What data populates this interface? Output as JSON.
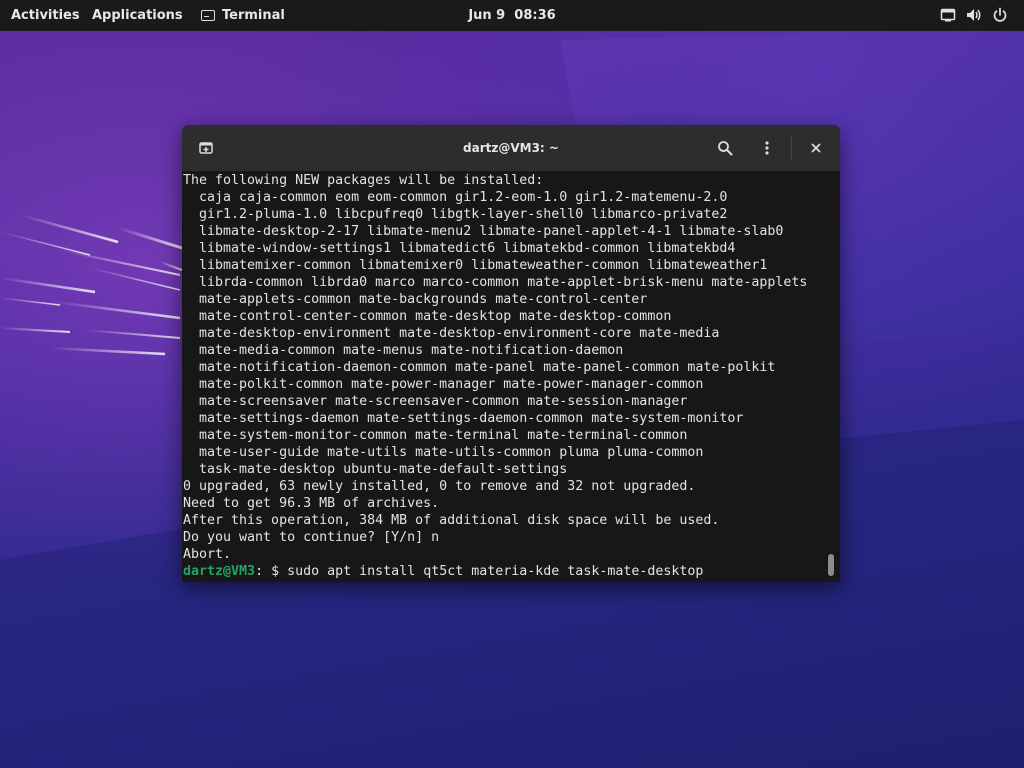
{
  "topbar": {
    "activities_label": "Activities",
    "applications_label": "Applications",
    "app_label": "Terminal",
    "clock": "Jun 9  08:36",
    "tray_icons": [
      "network-icon",
      "volume-icon",
      "power-icon"
    ]
  },
  "terminal": {
    "title": "dartz@VM3: ~",
    "header_icons": [
      "new-tab-icon",
      "search-icon",
      "menu-icon",
      "close-icon"
    ],
    "output_lines": [
      "The following NEW packages will be installed:",
      "  caja caja-common eom eom-common gir1.2-eom-1.0 gir1.2-matemenu-2.0",
      "  gir1.2-pluma-1.0 libcpufreq0 libgtk-layer-shell0 libmarco-private2",
      "  libmate-desktop-2-17 libmate-menu2 libmate-panel-applet-4-1 libmate-slab0",
      "  libmate-window-settings1 libmatedict6 libmatekbd-common libmatekbd4",
      "  libmatemixer-common libmatemixer0 libmateweather-common libmateweather1",
      "  librda-common librda0 marco marco-common mate-applet-brisk-menu mate-applets",
      "  mate-applets-common mate-backgrounds mate-control-center",
      "  mate-control-center-common mate-desktop mate-desktop-common",
      "  mate-desktop-environment mate-desktop-environment-core mate-media",
      "  mate-media-common mate-menus mate-notification-daemon",
      "  mate-notification-daemon-common mate-panel mate-panel-common mate-polkit",
      "  mate-polkit-common mate-power-manager mate-power-manager-common",
      "  mate-screensaver mate-screensaver-common mate-session-manager",
      "  mate-settings-daemon mate-settings-daemon-common mate-system-monitor",
      "  mate-system-monitor-common mate-terminal mate-terminal-common",
      "  mate-user-guide mate-utils mate-utils-common pluma pluma-common",
      "  task-mate-desktop ubuntu-mate-default-settings",
      "0 upgraded, 63 newly installed, 0 to remove and 32 not upgraded.",
      "Need to get 96.3 MB of archives.",
      "After this operation, 384 MB of additional disk space will be used.",
      "Do you want to continue? [Y/n] n",
      "Abort."
    ],
    "prompt": {
      "user_host": "dartz@VM3",
      "separator": ":",
      "path": " ",
      "symbol": "$",
      "command": " sudo apt install qt5ct materia-kde task-mate-desktop"
    }
  },
  "colors": {
    "topbar_bg": "#1a1a1a",
    "terminal_bg": "#171717",
    "header_bg": "#2d2d2d",
    "prompt_user": "#26a269",
    "prompt_path": "#2a7bde"
  }
}
